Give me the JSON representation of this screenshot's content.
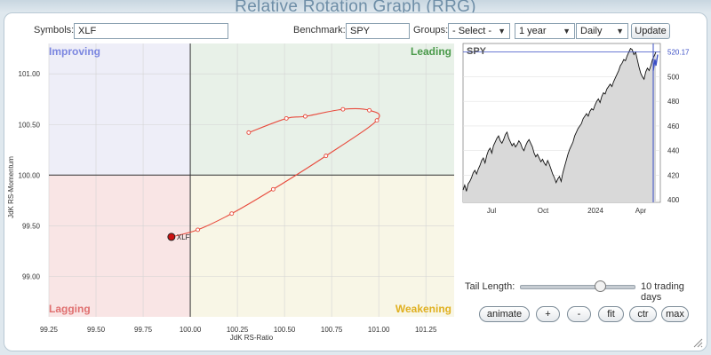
{
  "page": {
    "title": "Relative Rotation Graph (RRG)"
  },
  "toolbar": {
    "symbols_label": "Symbols:",
    "symbols_value": "XLF",
    "benchmark_label": "Benchmark:",
    "benchmark_value": "SPY",
    "groups_label": "Groups:",
    "groups_value": "- Select -",
    "period_value": "1 year",
    "frequency_value": "Daily",
    "update_label": "Update"
  },
  "rrg": {
    "xlabel": "JdK RS-Ratio",
    "ylabel": "JdK RS-Momentum",
    "xlim": [
      99.25,
      101.4
    ],
    "ylim": [
      98.6,
      101.3
    ],
    "x_ticks": [
      "99.25",
      "99.50",
      "99.75",
      "100.00",
      "100.25",
      "100.50",
      "100.75",
      "101.00",
      "101.25"
    ],
    "y_ticks": [
      "101.00",
      "100.50",
      "100.00",
      "99.50",
      "99.00"
    ],
    "quadrants": {
      "improving": "Improving",
      "leading": "Leading",
      "lagging": "Lagging",
      "weakening": "Weakening"
    },
    "colors": {
      "improving": "#7b86e0",
      "leading": "#4a9a4a",
      "lagging": "#e07070",
      "weakening": "#e0b020",
      "tail": "#e84a3c"
    },
    "series_label": "XLF"
  },
  "chart_data": {
    "type": "scatter",
    "series": [
      {
        "name": "XLF",
        "x": [
          100.31,
          100.51,
          100.61,
          100.81,
          100.95,
          100.99,
          100.72,
          100.44,
          100.22,
          100.04,
          99.9
        ],
        "y": [
          100.42,
          100.56,
          100.58,
          100.65,
          100.64,
          100.54,
          100.19,
          99.86,
          99.62,
          99.46,
          99.39
        ]
      }
    ],
    "xlabel": "JdK RS-Ratio",
    "ylabel": "JdK RS-Momentum",
    "xlim": [
      99.25,
      101.4
    ],
    "ylim": [
      98.6,
      101.3
    ]
  },
  "spy": {
    "label": "SPY",
    "last_value": "520.17",
    "y_ticks": [
      "500",
      "480",
      "460",
      "440",
      "420",
      "400"
    ],
    "x_ticks": [
      "Jul",
      "Oct",
      "2024",
      "Apr"
    ],
    "ylim": [
      398,
      527
    ],
    "prices": [
      408,
      412,
      407,
      413,
      415,
      418,
      422,
      424,
      421,
      425,
      428,
      432,
      434,
      430,
      436,
      440,
      442,
      438,
      444,
      447,
      450,
      452,
      448,
      446,
      449,
      453,
      455,
      450,
      447,
      444,
      446,
      443,
      445,
      448,
      446,
      442,
      440,
      444,
      447,
      449,
      446,
      443,
      438,
      435,
      437,
      434,
      431,
      433,
      430,
      428,
      432,
      429,
      425,
      421,
      418,
      414,
      417,
      419,
      415,
      422,
      427,
      432,
      437,
      441,
      444,
      447,
      452,
      455,
      458,
      460,
      462,
      466,
      468,
      470,
      468,
      472,
      474,
      473,
      477,
      480,
      482,
      479,
      484,
      487,
      486,
      490,
      492,
      494,
      492,
      496,
      499,
      502,
      505,
      509,
      511,
      514,
      513,
      517,
      520,
      523,
      522,
      518,
      520,
      514,
      508,
      503,
      500,
      498,
      504,
      507,
      505,
      509,
      514,
      517,
      520
    ]
  },
  "controls": {
    "tail_label": "Tail Length:",
    "tail_value": 10,
    "tail_max": 14,
    "tail_text": "10 trading days",
    "buttons": [
      "animate",
      "+",
      "-",
      "fit",
      "ctr",
      "max"
    ]
  }
}
